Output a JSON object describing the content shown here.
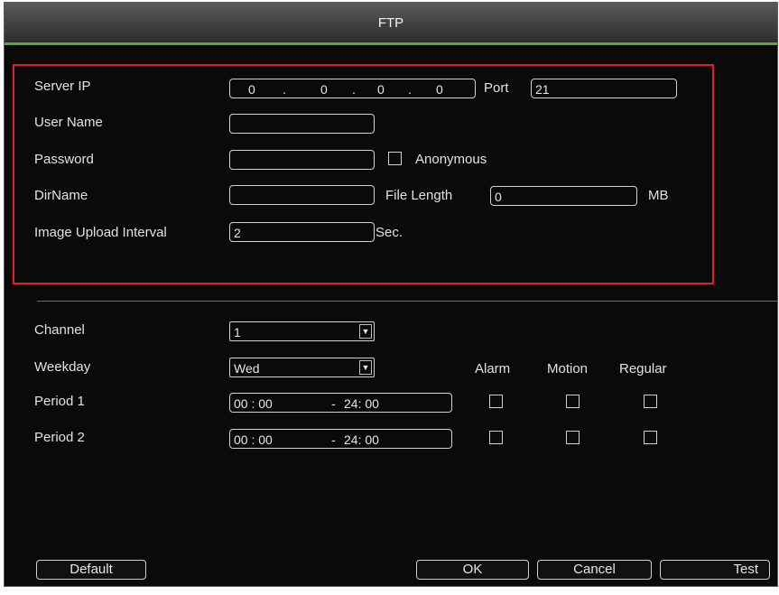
{
  "window": {
    "title": "FTP"
  },
  "ftp": {
    "server_ip_label": "Server IP",
    "server_ip": [
      "0",
      "0",
      "0",
      "0"
    ],
    "ip_dot": ".",
    "port_label": "Port",
    "port": "21",
    "user_name_label": "User Name",
    "user_name": "",
    "password_label": "Password",
    "password": "",
    "anonymous_label": "Anonymous",
    "anonymous_checked": false,
    "dirname_label": "DirName",
    "dirname": "",
    "file_length_label": "File Length",
    "file_length": "0",
    "file_length_unit": "MB",
    "upload_interval_label": "Image Upload Interval",
    "upload_interval": "2",
    "upload_interval_unit": "Sec."
  },
  "schedule": {
    "channel_label": "Channel",
    "channel": "1",
    "weekday_label": "Weekday",
    "weekday": "Wed",
    "columns": [
      "Alarm",
      "Motion",
      "Regular"
    ],
    "periods": [
      {
        "label": "Period 1",
        "start": "00 : 00",
        "dash": "-",
        "end": "24:  00"
      },
      {
        "label": "Period 2",
        "start": "00 : 00",
        "dash": "-",
        "end": "24:  00"
      }
    ]
  },
  "buttons": {
    "default": "Default",
    "ok": "OK",
    "cancel": "Cancel",
    "test": "Test"
  },
  "colors": {
    "highlight_border": "#e21f26",
    "title_underline": "#5aa83a",
    "background": "#0a0a0a"
  }
}
